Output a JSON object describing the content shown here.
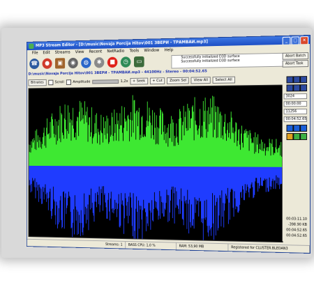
{
  "window": {
    "title": "MP3 Stream Editor - [D:\\music\\Novaja Porcija Hitov\\001 ЗВЕРИ - ТРАМВАИ.mp3]",
    "controls": [
      "_",
      "□",
      "×"
    ]
  },
  "menu": [
    "File",
    "Edit",
    "Streams",
    "View",
    "Recent",
    "NetRadio",
    "Tools",
    "Window",
    "Help"
  ],
  "toolbar": {
    "icons": [
      "phone-icon",
      "record-icon",
      "box-icon",
      "disc-icon",
      "globe-icon",
      "gear-icon",
      "stop-icon",
      "clock-icon",
      "cd-icon"
    ]
  },
  "log": {
    "lines": [
      "Successfully initialized D3D surface",
      "Successfully initialized D3D surface"
    ]
  },
  "abort": {
    "batch": "Abort Batch",
    "task": "Abort Task"
  },
  "file_path": "D:\\music\\Novaja Porcija Hitov\\001 ЗВЕРИ - ТРАМВАИ.mp3 - 44100Hz - Stereo - 00:04:52.65",
  "controls": {
    "bitrates": "Bitrates",
    "scroll": "Scroll",
    "amplitude": "Amplitude",
    "zoom_value": "1,2x",
    "seek": "+ Seek",
    "cut": "+ Cut",
    "zoom_sel": "Zoom Sel",
    "view_all": "View All",
    "select_all": "Select All"
  },
  "side": {
    "field1": "3024",
    "field2": "00:00:00",
    "field3": "11256",
    "field4": "00:04:52.65",
    "readouts": [
      "00:03:11.10",
      "-398.90 KB",
      "00:04:52.65",
      "00:04:52.65"
    ]
  },
  "status": {
    "streams": "Streams: 1",
    "cpu": "BASS CPU: 1,0 %",
    "ram": "RAM: 53,90 MB",
    "registered": "Registered for CLUSTER.BLEDAN3"
  },
  "colors": {
    "waveform_top": "#3ee832",
    "waveform_bottom": "#1f3cff",
    "title": "#1d4fc4"
  }
}
